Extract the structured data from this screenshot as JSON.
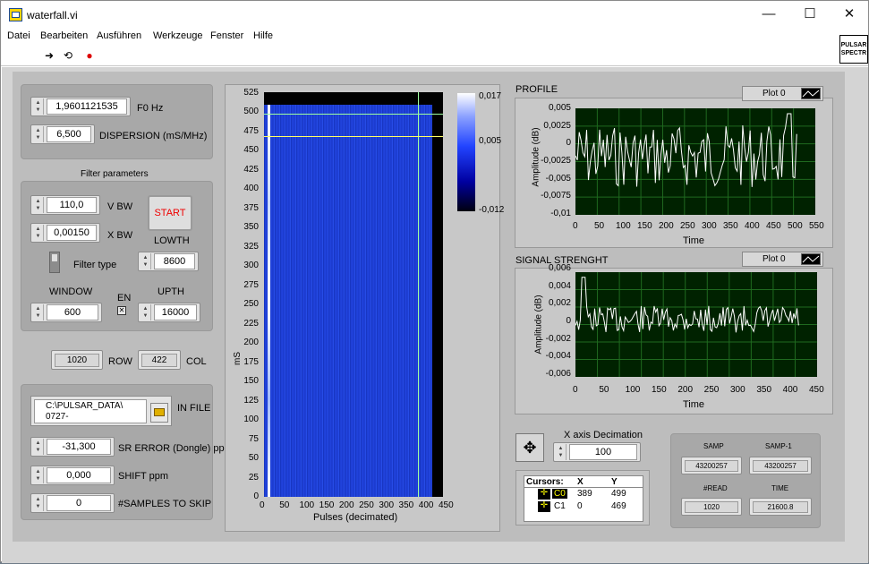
{
  "window": {
    "title": "waterfall.vi",
    "minimize": "—",
    "maximize": "☐",
    "close": "✕"
  },
  "menu": [
    "Datei",
    "Bearbeiten",
    "Ausführen",
    "Werkzeuge",
    "Fenster",
    "Hilfe"
  ],
  "toolbar": {
    "run": "➜",
    "run_continuous": "⟲",
    "abort": "●"
  },
  "vi_icon": "PULSAR SPECTR",
  "controls": {
    "f0": {
      "value": "1,9601121535",
      "label": "F0 Hz"
    },
    "dispersion": {
      "value": "6,500",
      "label": "DISPERSION (mS/MHz)"
    },
    "filter_title": "Filter parameters",
    "vbw": {
      "value": "110,0",
      "label": "V BW"
    },
    "xbw": {
      "value": "0,00150",
      "label": "X BW"
    },
    "start": "START",
    "lowth": {
      "label": "LOWTH",
      "value": "8600"
    },
    "filter_type": "Filter type",
    "window": {
      "label": "WINDOW",
      "value": "600"
    },
    "en": "EN",
    "upth": {
      "label": "UPTH",
      "value": "16000"
    },
    "row": {
      "value": "1020",
      "label": "ROW"
    },
    "col": {
      "value": "422",
      "label": "COL"
    },
    "in_file": {
      "value": "C:\\PULSAR_DATA\\ 0727-",
      "label": "IN FILE"
    },
    "sr_error": {
      "value": "-31,300",
      "label": "SR ERROR (Dongle) ppm"
    },
    "shift": {
      "value": "0,000",
      "label": "SHIFT ppm"
    },
    "skip": {
      "value": "0",
      "label": "#SAMPLES TO SKIP"
    }
  },
  "waterfall": {
    "ylabel": "mS",
    "xlabel": "Pulses (decimated)",
    "yticks": [
      "525",
      "500",
      "475",
      "450",
      "425",
      "400",
      "375",
      "350",
      "325",
      "300",
      "275",
      "250",
      "225",
      "200",
      "175",
      "150",
      "125",
      "100",
      "75",
      "50",
      "25",
      "0"
    ],
    "xticks": [
      "0",
      "50",
      "100",
      "150",
      "200",
      "250",
      "300",
      "350",
      "400",
      "450"
    ],
    "colorbar": [
      "0,017",
      "0,005",
      "-0,012"
    ]
  },
  "profile": {
    "title": "PROFILE",
    "legend": "Plot 0",
    "ylabel": "Amplitude (dB)",
    "xlabel": "Time",
    "yticks": [
      "0,005",
      "0,0025",
      "0",
      "-0,0025",
      "-0,005",
      "-0,0075",
      "-0,01"
    ],
    "xticks": [
      "0",
      "50",
      "100",
      "150",
      "200",
      "250",
      "300",
      "350",
      "400",
      "450",
      "500",
      "550"
    ]
  },
  "signal": {
    "title": "SIGNAL STRENGHT",
    "legend": "Plot 0",
    "ylabel": "Amplitude (dB)",
    "xlabel": "Time",
    "yticks": [
      "0,006",
      "0,004",
      "0,002",
      "0",
      "-0,002",
      "-0,004",
      "-0,006"
    ],
    "xticks": [
      "0",
      "50",
      "100",
      "150",
      "200",
      "250",
      "300",
      "350",
      "400",
      "450"
    ]
  },
  "decimation": {
    "label": "X axis Decimation",
    "value": "100"
  },
  "cursors": {
    "header": [
      "Cursors:",
      "X",
      "Y"
    ],
    "rows": [
      [
        "C0",
        "389",
        "499"
      ],
      [
        "C1",
        "0",
        "469"
      ]
    ]
  },
  "timing": {
    "samp_label": "SAMP",
    "samp": "43200257",
    "samp1_label": "SAMP-1",
    "samp1": "43200257",
    "read_label": "#READ",
    "read": "1020",
    "time_label": "TIME",
    "time": "21600.8"
  },
  "colors": {
    "plot_bg": "#002200",
    "grid": "#1f6a1f",
    "trace": "#ffffff",
    "waterfall": "#1a3fd0",
    "cursor": "#ffff66"
  }
}
